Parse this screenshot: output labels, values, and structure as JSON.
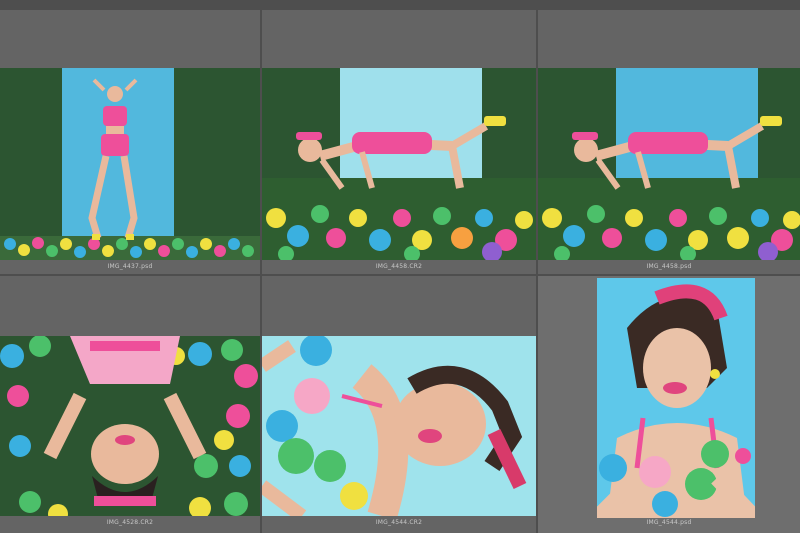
{
  "grid": {
    "cells": [
      {
        "filename": "IMG_4437.psd",
        "scene": "standing-backdrop"
      },
      {
        "filename": "IMG_4458.CR2",
        "scene": "crawling-ballpit"
      },
      {
        "filename": "IMG_4458.psd",
        "scene": "crawling-ballpit"
      },
      {
        "filename": "IMG_4528.CR2",
        "scene": "lying-upside-down"
      },
      {
        "filename": "IMG_4544.CR2",
        "scene": "portrait-rotated"
      },
      {
        "filename": "IMG_4544.psd",
        "scene": "portrait-vertical"
      }
    ]
  },
  "colors": {
    "grass": "#2f5a33",
    "backdrop_blue": "#5ec3e4",
    "pink": "#ee4f9a",
    "panel": "#646464"
  }
}
